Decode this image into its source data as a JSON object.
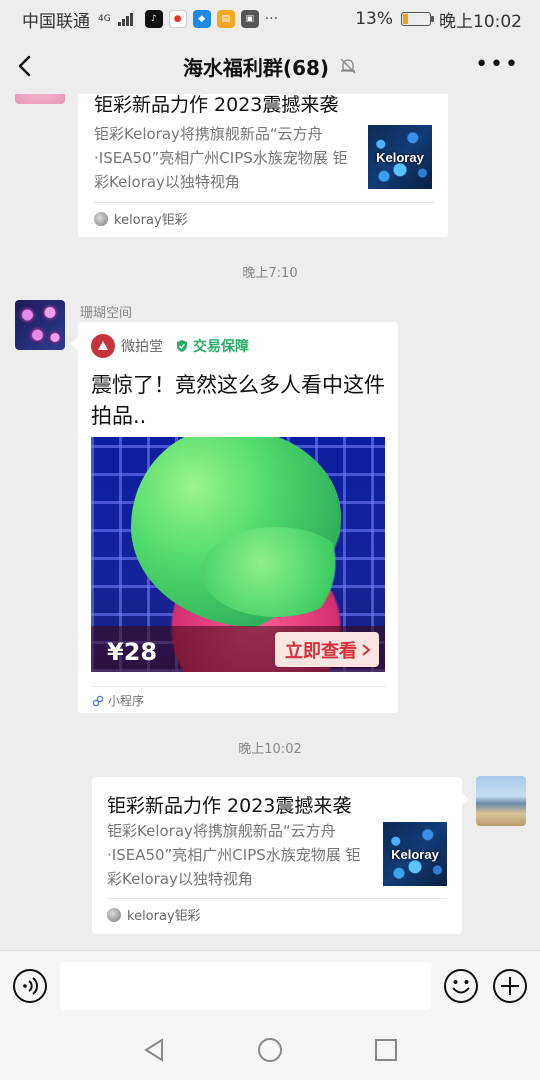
{
  "status_bar": {
    "carrier": "中国联通",
    "network": "4G",
    "battery": "13%",
    "time": "晚上10:02",
    "more": "···"
  },
  "nav": {
    "title": "海水福利群(68)"
  },
  "messages": {
    "link_card_1": {
      "title": "钜彩新品力作 2023震撼来袭",
      "desc": "钜彩Keloray将携旗舰新品“云方舟·ISEA50”亮相广州CIPS水族宠物展 钜彩Keloray以独特视角",
      "thumb_text": "Keloray",
      "source": "keloray钜彩"
    },
    "time_1": "晚上7:10",
    "sender_1": "珊瑚空间",
    "miniprogram": {
      "app_name": "微拍堂",
      "guarantee": "交易保障",
      "title": "震惊了！竟然这么多人看中这件拍品..",
      "price": "¥28",
      "button": "立即查看",
      "footer": "小程序"
    },
    "time_2": "晚上10:02",
    "link_card_2": {
      "title": "钜彩新品力作 2023震撼来袭",
      "desc": "钜彩Keloray将携旗舰新品“云方舟·ISEA50”亮相广州CIPS水族宠物展 钜彩Keloray以独特视角",
      "thumb_text": "Keloray",
      "source": "keloray钜彩"
    }
  },
  "input": {
    "value": ""
  },
  "colors": {
    "background": "#ededed",
    "guarantee_green": "#2aae67",
    "buy_red": "#d4313b",
    "battery_orange": "#f39b1a"
  }
}
